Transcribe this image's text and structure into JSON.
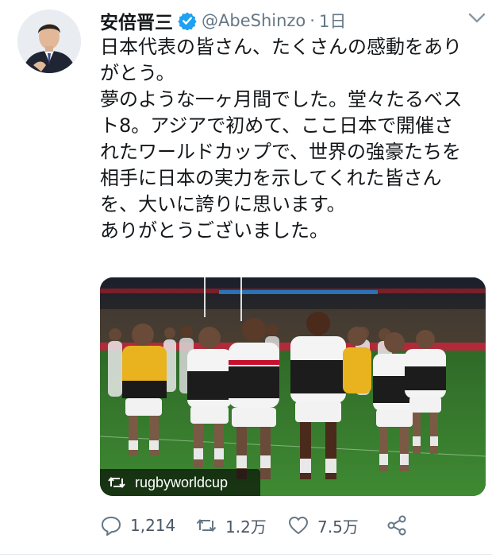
{
  "tweet": {
    "display_name": "安倍晋三",
    "handle": "@AbeShinzo",
    "separator": "·",
    "time": "1日",
    "lines": [
      "日本代表の皆さん、たくさんの感動をあり",
      "がとう。",
      "夢のような一ヶ月間でした。堂々たるベス",
      "ト8。アジアで初めて、ここ日本で開催さ",
      "れたワールドカップで、世界の強豪たちを",
      "相手に日本の実力を示してくれた皆さん",
      "を、大いに誇りに思います。",
      "ありがとうございました。"
    ]
  },
  "media": {
    "retweeted_from": "rugbyworldcup",
    "icon": "retweet-icon"
  },
  "actions": {
    "reply_count": "1,214",
    "retweet_count": "1.2万",
    "like_count": "7.5万"
  },
  "colors": {
    "verified": "#1da1f2",
    "icon_gray": "#657786",
    "text": "#14171a",
    "pitch_green": "#3c7a2f"
  }
}
